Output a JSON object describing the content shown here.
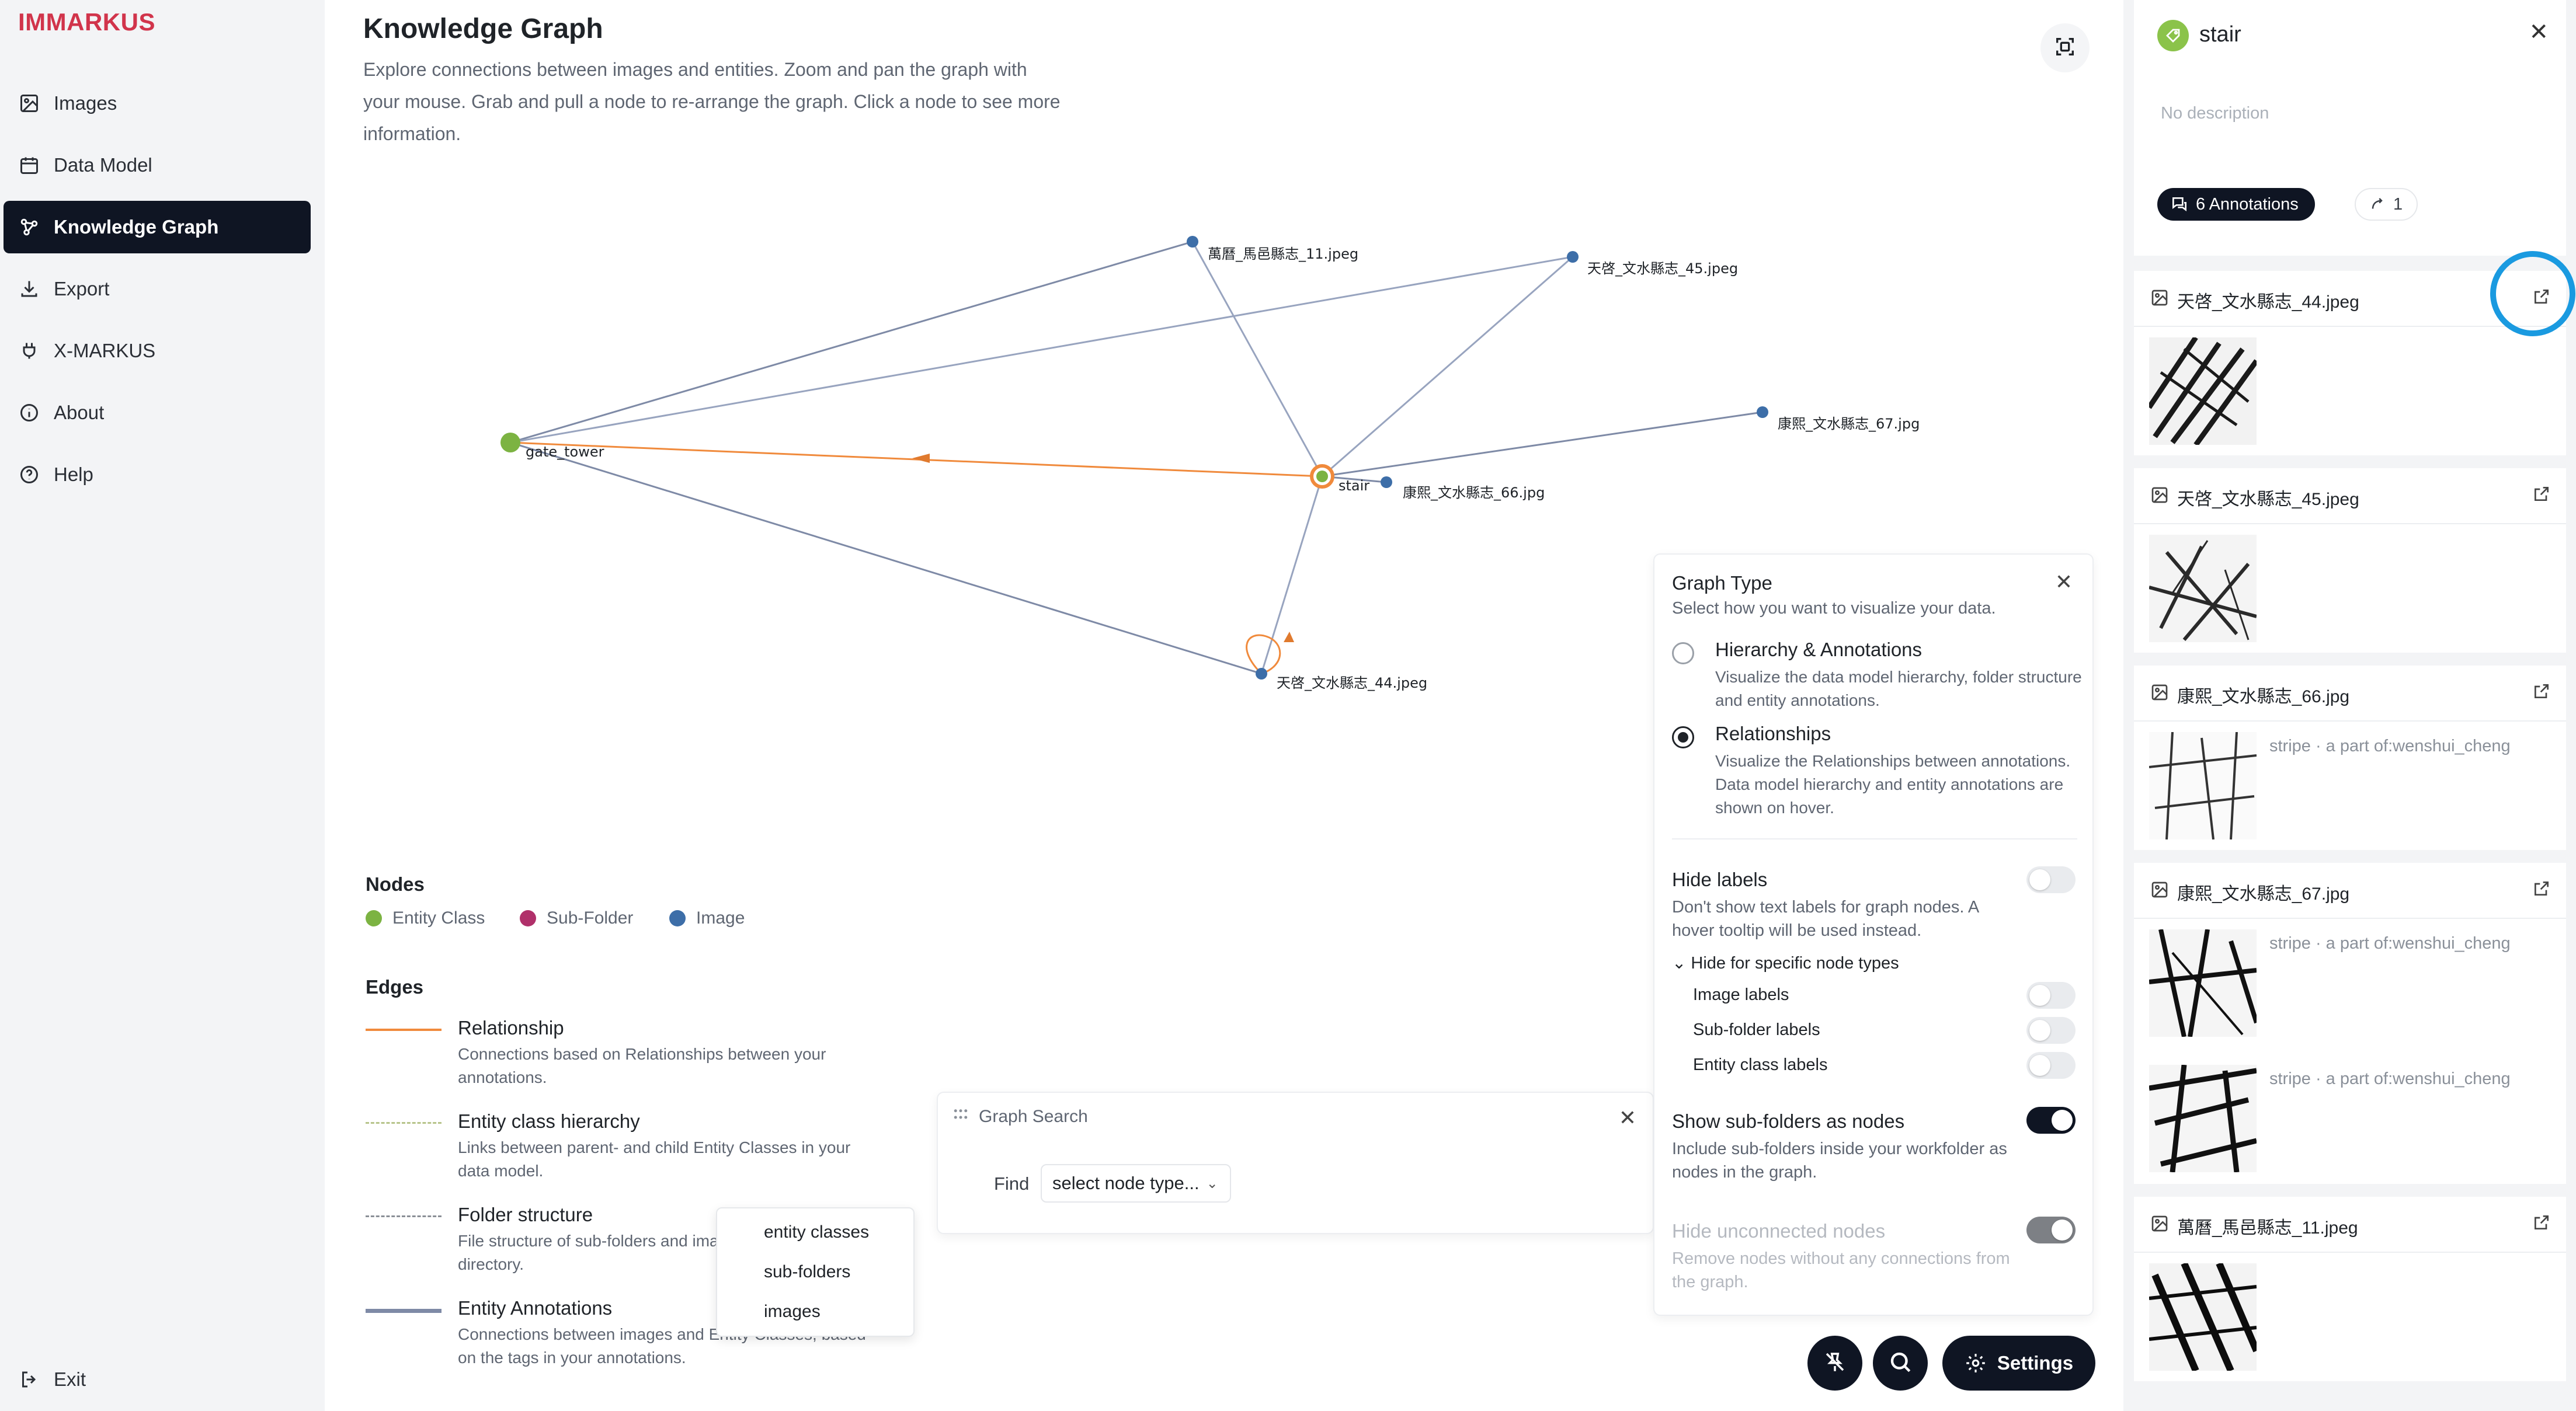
{
  "brand": "IMMARKUS",
  "nav": {
    "items": [
      {
        "label": "Images",
        "icon": "image-icon"
      },
      {
        "label": "Data Model",
        "icon": "calendar-icon"
      },
      {
        "label": "Knowledge Graph",
        "icon": "graph-icon"
      },
      {
        "label": "Export",
        "icon": "download-icon"
      },
      {
        "label": "X-MARKUS",
        "icon": "plug-icon"
      },
      {
        "label": "About",
        "icon": "info-icon"
      },
      {
        "label": "Help",
        "icon": "help-icon"
      }
    ],
    "active": "Knowledge Graph",
    "exit_label": "Exit"
  },
  "page": {
    "title": "Knowledge Graph",
    "description": "Explore connections between images and entities. Zoom and pan the graph with your mouse. Grab and pull a node to re-arrange the graph. Click a node to see more information."
  },
  "graph": {
    "nodes": [
      {
        "label": "gate_tower",
        "type": "entity"
      },
      {
        "label": "stair",
        "type": "entity"
      },
      {
        "label": "萬曆_馬邑縣志_11.jpeg",
        "type": "image"
      },
      {
        "label": "天啓_文水縣志_45.jpeg",
        "type": "image"
      },
      {
        "label": "康熙_文水縣志_67.jpg",
        "type": "image"
      },
      {
        "label": "康熙_文水縣志_66.jpg",
        "type": "image"
      },
      {
        "label": "天啓_文水縣志_44.jpeg",
        "type": "image"
      }
    ],
    "colors": {
      "entity": "#7cb342",
      "image": "#3d6ea8",
      "subfolder": "#b0306a",
      "relationship": "#f08a3c",
      "annotation": "#7e8aa6",
      "selected_ring": "#f08a3c"
    }
  },
  "legend": {
    "nodes_heading": "Nodes",
    "node_types": [
      {
        "label": "Entity Class",
        "color": "#7cb342"
      },
      {
        "label": "Sub-Folder",
        "color": "#b0306a"
      },
      {
        "label": "Image",
        "color": "#3d6ea8"
      }
    ],
    "edges_heading": "Edges",
    "edge_types": [
      {
        "name": "Relationship",
        "desc": "Connections based on Relationships between your annotations."
      },
      {
        "name": "Entity class hierarchy",
        "desc": "Links between parent- and child Entity Classes in your data model."
      },
      {
        "name": "Folder structure",
        "desc": "File structure of sub-folders and image files in your project directory."
      },
      {
        "name": "Entity Annotations",
        "desc": "Connections between images and Entity Classes, based on the tags in your annotations."
      }
    ]
  },
  "search": {
    "title": "Graph Search",
    "find_label": "Find",
    "select_value": "select node type...",
    "options": [
      "entity classes",
      "sub-folders",
      "images"
    ]
  },
  "settings": {
    "title": "Graph Type",
    "subtitle": "Select how you want to visualize your data.",
    "graph_types": [
      {
        "label": "Hierarchy & Annotations",
        "desc": "Visualize the data model hierarchy, folder structure and entity annotations.",
        "selected": false
      },
      {
        "label": "Relationships",
        "desc": "Visualize the Relationships between annotations. Data model hierarchy and entity annotations are shown on hover.",
        "selected": true
      }
    ],
    "hide_labels": {
      "label": "Hide labels",
      "desc": "Don't show text labels for graph nodes. A hover tooltip will be used instead.",
      "on": false
    },
    "hide_specific": {
      "label": "Hide for specific node types",
      "items": [
        {
          "label": "Image labels",
          "on": false
        },
        {
          "label": "Sub-folder labels",
          "on": false
        },
        {
          "label": "Entity class labels",
          "on": false
        }
      ]
    },
    "show_subfolders": {
      "label": "Show sub-folders as nodes",
      "desc": "Include sub-folders inside your workfolder as nodes in the graph.",
      "on": true
    },
    "hide_unconnected": {
      "label": "Hide unconnected nodes",
      "desc": "Remove nodes without any connections from the graph.",
      "on": true,
      "disabled": true
    },
    "button_label": "Settings"
  },
  "detail": {
    "entity_name": "stair",
    "description": "No description",
    "annotations_badge": "6 Annotations",
    "relations_count": "1",
    "cards": [
      {
        "filename": "天啓_文水縣志_44.jpeg",
        "annotations": [
          ""
        ]
      },
      {
        "filename": "天啓_文水縣志_45.jpeg",
        "annotations": [
          ""
        ]
      },
      {
        "filename": "康熙_文水縣志_66.jpg",
        "annotations": [
          "stripe · a part of:wenshui_cheng"
        ]
      },
      {
        "filename": "康熙_文水縣志_67.jpg",
        "annotations": [
          "stripe · a part of:wenshui_cheng",
          "stripe · a part of:wenshui_cheng"
        ]
      },
      {
        "filename": "萬曆_馬邑縣志_11.jpeg",
        "annotations": [
          ""
        ]
      }
    ]
  }
}
